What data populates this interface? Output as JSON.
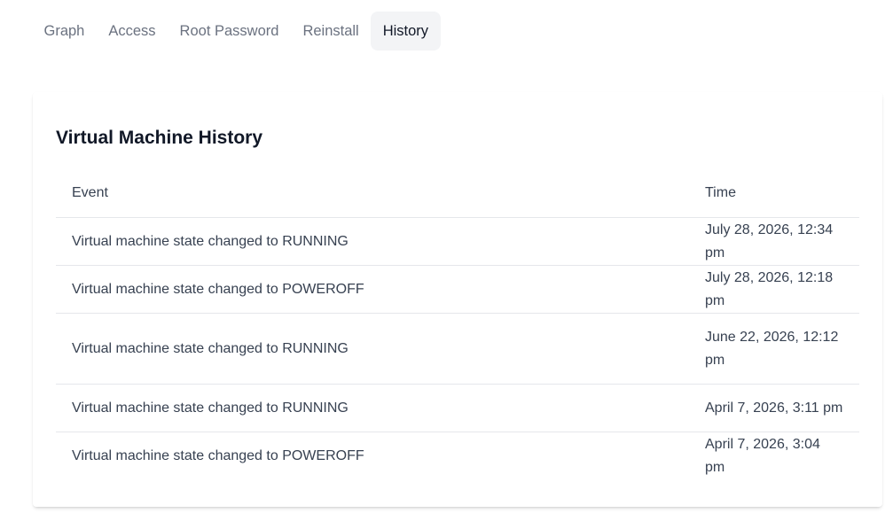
{
  "tabs": [
    {
      "label": "Graph",
      "active": false
    },
    {
      "label": "Access",
      "active": false
    },
    {
      "label": "Root Password",
      "active": false
    },
    {
      "label": "Reinstall",
      "active": false
    },
    {
      "label": "History",
      "active": true
    }
  ],
  "history": {
    "title": "Virtual Machine History",
    "columns": {
      "event": "Event",
      "time": "Time"
    },
    "rows": [
      {
        "event": "Virtual machine state changed to RUNNING",
        "time": "July 28, 2026, 12:34 pm"
      },
      {
        "event": "Virtual machine state changed to POWEROFF",
        "time": "July 28, 2026, 12:18 pm"
      },
      {
        "event": "Virtual machine state changed to RUNNING",
        "time": "June 22, 2026, 12:12 pm"
      },
      {
        "event": "Virtual machine state changed to RUNNING",
        "time": "April 7, 2026, 3:11 pm"
      },
      {
        "event": "Virtual machine state changed to POWEROFF",
        "time": "April 7, 2026, 3:04 pm"
      }
    ]
  }
}
